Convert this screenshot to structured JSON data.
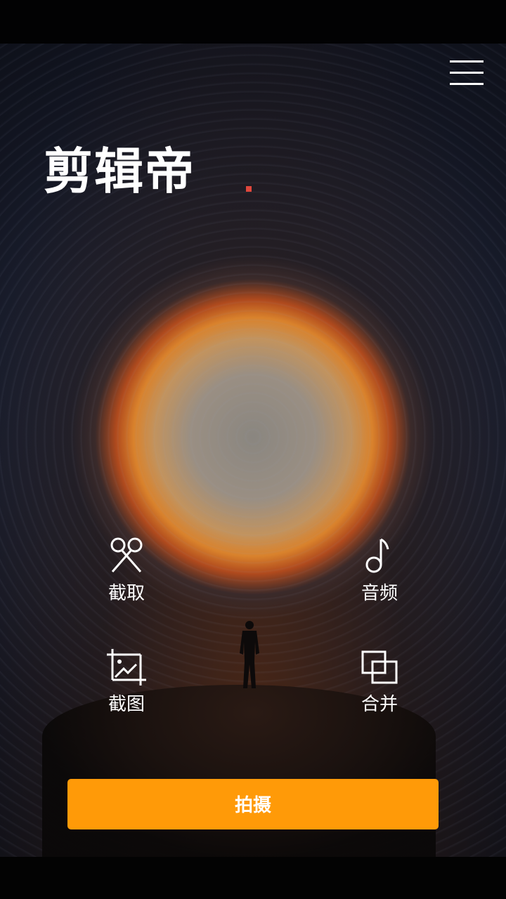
{
  "app": {
    "title": "剪辑帝"
  },
  "header": {
    "menu_icon": "hamburger-menu-icon"
  },
  "tools": [
    {
      "label": "截取",
      "icon": "scissors-icon"
    },
    {
      "label": "音频",
      "icon": "music-note-icon"
    },
    {
      "label": "截图",
      "icon": "crop-image-icon"
    },
    {
      "label": "合并",
      "icon": "merge-squares-icon"
    }
  ],
  "actions": {
    "shoot_label": "拍摄"
  },
  "colors": {
    "accent": "#ff9a08",
    "indicator": "#e0473c",
    "text": "#ffffff"
  }
}
